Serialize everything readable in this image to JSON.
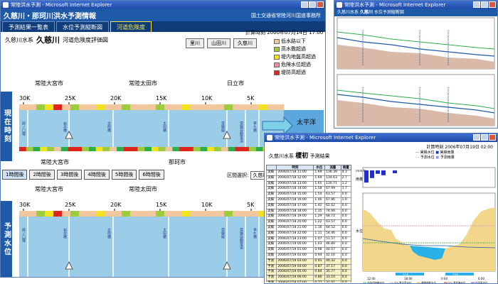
{
  "main_window": {
    "title": "常陸洪水予測 - Microsoft Internet Explorer",
    "header_title": "久慈川・那珂川洪水予測情報",
    "organization": "国土交通省常陸河川国道事務所",
    "tabs": [
      {
        "label": "予測結果一覧表"
      },
      {
        "label": "水位予測縦断図"
      },
      {
        "label": "河道危険度"
      }
    ],
    "calc_time": "計算時刻 2000年07月14日 17:00",
    "water_system": "久慈川水系",
    "river": "久慈川",
    "diagram_title": "河道危険度評価図",
    "river_buttons": [
      {
        "label": "里川"
      },
      {
        "label": "山田川"
      },
      {
        "label": "久慈川"
      }
    ],
    "legend": [
      {
        "label": "低水路以下",
        "color": "#f2c79d"
      },
      {
        "label": "高水敷超過",
        "color": "#9ccc3b"
      },
      {
        "label": "堤内地盤高超過",
        "color": "#f2e21f"
      },
      {
        "label": "危険水位超過",
        "color": "#f08ca0"
      },
      {
        "label": "堤防高超過",
        "color": "#e0231c"
      }
    ],
    "present_label": "現在時刻",
    "forecast_label": "予測水位",
    "top_cities": [
      "常陸大宮市",
      "常陸太田市",
      "日立市"
    ],
    "bottom_cities": [
      "常陸大宮市",
      "那珂市",
      "東海"
    ],
    "forecast_cities": [
      "常陸大宮市",
      "常陸太田市"
    ],
    "km_marks": [
      "30K",
      "25K",
      "20K",
      "15K",
      "10K",
      "5K"
    ],
    "sea_label": "太平洋",
    "vertical_labels": [
      "辰ノ口堰",
      "岩井橋",
      "太郎橋",
      "太田橋",
      "常磐線",
      "常磐自動車道",
      "幸久橋",
      "榊橋"
    ],
    "hour_buttons": [
      {
        "label": "1時間後"
      },
      {
        "label": "2時間後"
      },
      {
        "label": "3時間後"
      },
      {
        "label": "4時間後"
      },
      {
        "label": "5時間後"
      },
      {
        "label": "6時間後"
      }
    ],
    "region_select_label": "区間選択:",
    "region_select_value": "久慈川全川"
  },
  "top_right_window": {
    "title": "常陸洪水予測 - Microsoft Internet Explorer",
    "water_system": "久慈川水系",
    "river": "久慈川",
    "subtitle": "水位予測縦断図"
  },
  "bottom_right_window": {
    "title": "常陸洪水予測 - Microsoft Internet Explorer",
    "calc_time": "計算時刻  2006年07月19日 02:00",
    "water_system": "久慈川水系",
    "river": "榎初",
    "subtitle": "予測結果",
    "legend": [
      {
        "label": "実績水位"
      },
      {
        "label": "実績雨量"
      },
      {
        "label": "予測水位"
      },
      {
        "label": "予測雨量"
      }
    ],
    "table_headers": [
      "",
      "時刻",
      "水位",
      "流量",
      "雨量"
    ],
    "table_rows": [
      [
        "実績",
        "2006/07/18 11:00",
        "1.69",
        "136.39",
        "4.3"
      ],
      [
        "実績",
        "2006/07/18 12:00",
        "1.69",
        "134.63",
        "2.7"
      ],
      [
        "実績",
        "2006/07/18 13:00",
        "1.65",
        "130.71",
        "1.2"
      ],
      [
        "実績",
        "2006/07/18 14:00",
        "1.58",
        "67.99",
        "1.7"
      ],
      [
        "実績",
        "2006/07/18 15:00",
        "1.54",
        "63.57",
        "0.0"
      ],
      [
        "実績",
        "2006/07/18 16:00",
        "1.46",
        "67.86",
        "1.0"
      ],
      [
        "実績",
        "2006/07/18 17:00",
        "1.42",
        "61.62",
        "0.0"
      ],
      [
        "実績",
        "2006/07/18 18:00",
        "1.35",
        "74.66",
        "0.0"
      ],
      [
        "実績",
        "2006/07/18 19:00",
        "1.29",
        "68.72",
        "0.0"
      ],
      [
        "実績",
        "2006/07/18 20:00",
        "1.22",
        "63.57",
        "0.0"
      ],
      [
        "実績",
        "2006/07/18 21:00",
        "1.16",
        "64.52",
        "0.0"
      ],
      [
        "実績",
        "2006/07/18 22:00",
        "1.11",
        "54.46",
        "0.0"
      ],
      [
        "実績",
        "2006/07/18 23:00",
        "1.07",
        "51.57",
        "0.0"
      ],
      [
        "実績",
        "2006/07/19 00:00",
        "1.03",
        "46.80",
        "0.0"
      ],
      [
        "実績",
        "2006/07/19 01:00",
        "0.98",
        "44.07",
        "0.0"
      ],
      [
        "実績",
        "2006/07/19 02:00",
        "0.94",
        "42.16",
        "0.0"
      ],
      [
        "予測",
        "2006/07/19 03:00",
        "0.91",
        "40.32",
        "0.0"
      ],
      [
        "予測",
        "2006/07/19 04:00",
        "0.87",
        "37.17",
        "0.0"
      ],
      [
        "予測",
        "2006/07/19 05:00",
        "0.84",
        "35.77",
        "0.0"
      ],
      [
        "予測",
        "2006/07/19 06:00",
        "0.80",
        "33.10",
        "0.0"
      ],
      [
        "予測",
        "2006/07/19 07:00",
        "0.77",
        "31.01",
        "0.0"
      ],
      [
        "予測",
        "2006/07/19 08:00",
        "0.74",
        "29.27",
        "0.0"
      ]
    ],
    "rain_axis_label": "雨量",
    "level_axis_label": "水位",
    "rain_unit": "(mm/h)",
    "x_ticks": [
      "12:00",
      "18:00",
      "0:00",
      "6:00"
    ],
    "date_labels": [
      "7/18",
      "7/19"
    ],
    "bottom_legend": [
      {
        "label": "水防団待機水位"
      },
      {
        "label": "はん濫注意水位"
      },
      {
        "label": "避難判断水位"
      },
      {
        "label": "はん濫危険水位"
      },
      {
        "label": "計画高水位"
      }
    ]
  },
  "colors": {
    "header_blue": "#1f5aa8",
    "tab_bg": "#0e3d7a",
    "river_blue": "#9ccde8",
    "sea_blue": "#5ba6dd"
  }
}
